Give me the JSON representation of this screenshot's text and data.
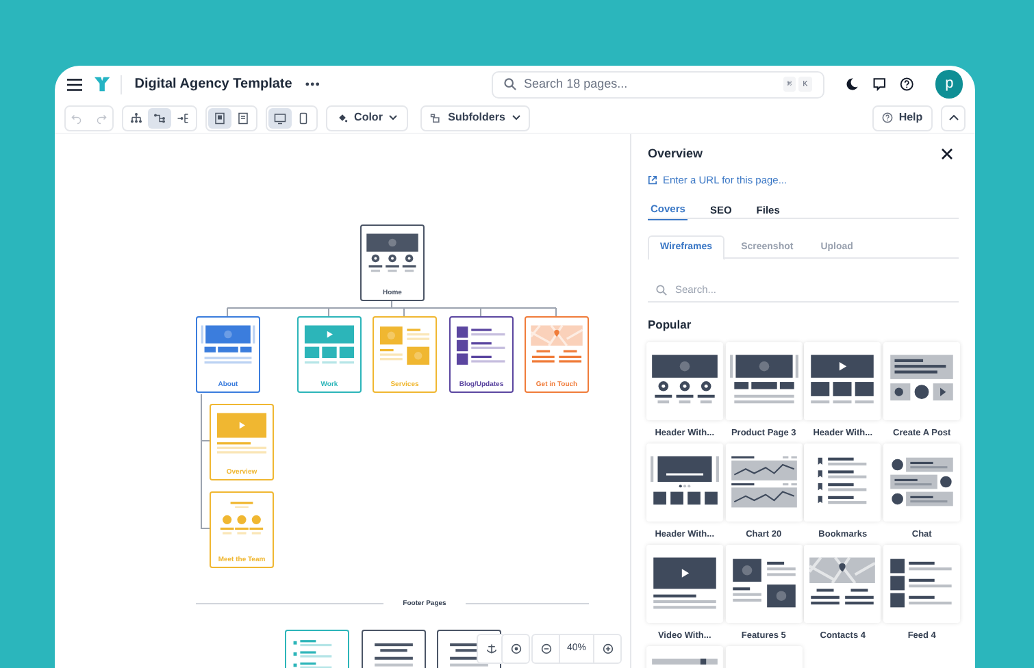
{
  "header": {
    "title": "Digital Agency Template",
    "search": {
      "placeholder": "Search 18 pages...",
      "keys": [
        "⌘",
        "K"
      ]
    },
    "avatar": "p"
  },
  "toolbar": {
    "history": [
      {
        "kind": "undo",
        "disabled": true
      },
      {
        "kind": "redo",
        "disabled": true
      }
    ],
    "views": [
      {
        "kind": "tree",
        "selected": false
      },
      {
        "kind": "branch",
        "selected": true
      },
      {
        "kind": "flow",
        "selected": false
      }
    ],
    "layouts": [
      {
        "kind": "doc-filled",
        "selected": true
      },
      {
        "kind": "doc",
        "selected": false
      }
    ],
    "devices": [
      {
        "kind": "desktop",
        "selected": true
      },
      {
        "kind": "mobile",
        "selected": false
      }
    ],
    "color_menu": "Color",
    "folders_menu": "Subfolders",
    "help": "Help"
  },
  "sitemap": {
    "root": {
      "label": "Home",
      "kind": "hero",
      "color": "#4b5566",
      "children": [
        {
          "label": "About",
          "kind": "product",
          "color": "#3b7ddd",
          "children": [
            {
              "label": "Overview",
              "kind": "video",
              "color": "#f0b731"
            },
            {
              "label": "Meet the Team",
              "kind": "team",
              "color": "#f0b731"
            }
          ]
        },
        {
          "label": "Work",
          "kind": "video-grid",
          "color": "#2cb5b9"
        },
        {
          "label": "Services",
          "kind": "split",
          "color": "#f0b731"
        },
        {
          "label": "Blog/Updates",
          "kind": "list",
          "color": "#5b46a0"
        },
        {
          "label": "Get in Touch",
          "kind": "map",
          "color": "#f07c3a"
        }
      ]
    },
    "footer_label": "Footer Pages",
    "footer": [
      {
        "kind": "bullets",
        "color": "#2cb5b9"
      },
      {
        "kind": "text",
        "color": "#4b5566"
      },
      {
        "kind": "text",
        "color": "#4b5566"
      }
    ],
    "zoom": "40%"
  },
  "panel": {
    "title": "Overview",
    "url_link": "Enter a URL for this page...",
    "tabs": [
      {
        "label": "Covers",
        "selected": true
      },
      {
        "label": "SEO",
        "selected": false
      },
      {
        "label": "Files",
        "selected": false
      }
    ],
    "subtabs": [
      {
        "label": "Wireframes",
        "selected": true
      },
      {
        "label": "Screenshot",
        "selected": false
      },
      {
        "label": "Upload",
        "selected": false
      }
    ],
    "search_placeholder": "Search...",
    "section": "Popular",
    "covers": [
      {
        "label": "Header With...",
        "kind": "hero"
      },
      {
        "label": "Product Page 3",
        "kind": "product"
      },
      {
        "label": "Header With...",
        "kind": "video-grid"
      },
      {
        "label": "Create A Post",
        "kind": "post"
      },
      {
        "label": "Header With...",
        "kind": "carousel"
      },
      {
        "label": "Chart 20",
        "kind": "chart"
      },
      {
        "label": "Bookmarks",
        "kind": "bookmarks"
      },
      {
        "label": "Chat",
        "kind": "chat"
      },
      {
        "label": "Video With...",
        "kind": "video"
      },
      {
        "label": "Features 5",
        "kind": "split"
      },
      {
        "label": "Contacts 4",
        "kind": "map"
      },
      {
        "label": "Feed 4",
        "kind": "list"
      },
      {
        "kind": "table"
      },
      {
        "kind": "blank"
      }
    ]
  }
}
